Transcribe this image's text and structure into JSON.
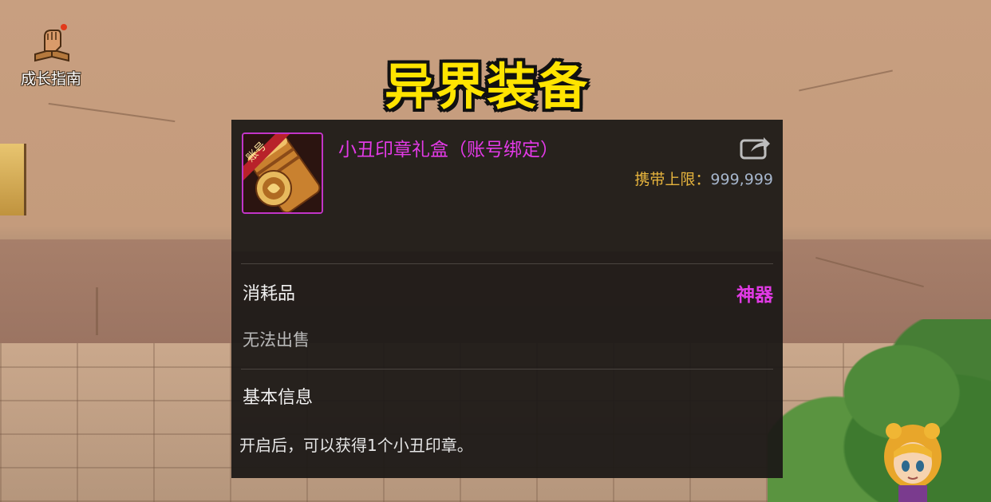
{
  "hud": {
    "guide_label": "成长指南"
  },
  "overlay_title": "异界装备",
  "item": {
    "badge": "账号",
    "name": "小丑印章礼盒（账号绑定）",
    "limit_label": "携带上限：",
    "limit_value": "999,999",
    "type": "消耗品",
    "rarity": "神器",
    "sell_status": "无法出售",
    "section_title": "基本信息",
    "description": "开启后，可以获得1个小丑印章。"
  },
  "colors": {
    "rarity": "#e23ae6",
    "title_yellow": "#ffe400",
    "limit_label": "#e6b43d",
    "limit_value": "#a6b6cc"
  },
  "icons": [
    "growth-guide-icon",
    "item-seal-box-icon",
    "share-export-icon"
  ]
}
